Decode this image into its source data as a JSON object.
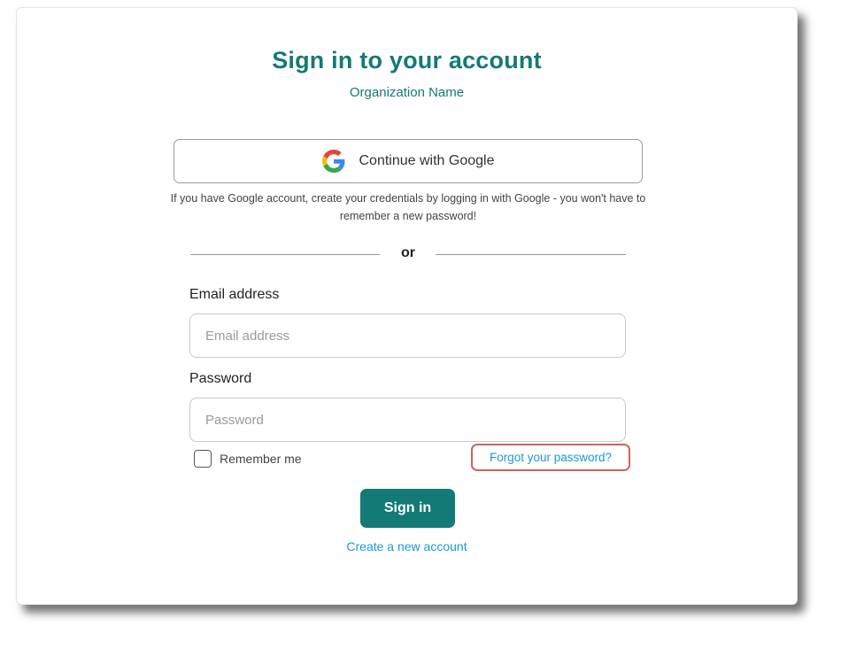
{
  "header": {
    "title": "Sign in to your account",
    "organization": "Organization Name"
  },
  "google": {
    "button_label": "Continue with Google",
    "hint": "If you have Google account, create your credentials by logging in with Google - you won't have to remember a new password!"
  },
  "divider": {
    "text": "or"
  },
  "form": {
    "email_label": "Email address",
    "email_placeholder": "Email address",
    "email_value": "",
    "password_label": "Password",
    "password_placeholder": "Password",
    "password_value": "",
    "remember_label": "Remember me",
    "remember_checked": false,
    "forgot_label": "Forgot your password?",
    "signin_label": "Sign in",
    "create_account_label": "Create a new account"
  },
  "colors": {
    "brand": "#137a75",
    "link": "#1a9ad8",
    "highlight": "#d0625f"
  },
  "icons": {
    "google": "google-g-icon"
  }
}
